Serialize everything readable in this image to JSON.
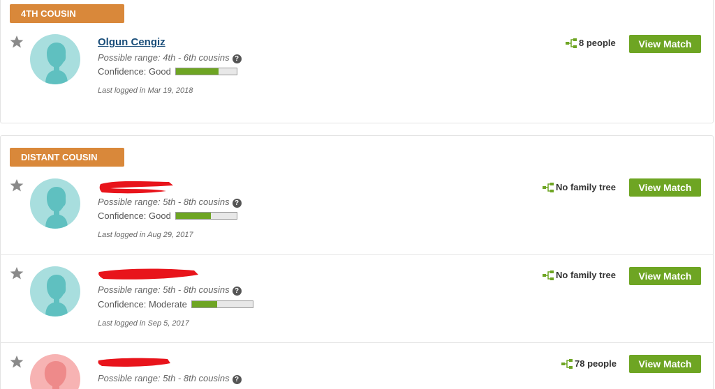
{
  "groups": [
    {
      "label": "4TH COUSIN"
    },
    {
      "label": "DISTANT COUSIN"
    }
  ],
  "matches": [
    {
      "name": "Olgun Cengiz",
      "range": "Possible range: 4th - 6th cousins",
      "confidence_text": "Confidence: Good",
      "confidence_level": 0.7,
      "last_logged": "Last logged in Mar 19, 2018",
      "tree": "8 people",
      "button": "View Match",
      "avatar": "male-silhouette"
    },
    {
      "name_redacted": true,
      "range": "Possible range: 5th - 8th cousins",
      "confidence_text": "Confidence: Good",
      "confidence_level": 0.58,
      "last_logged": "Last logged in Aug 29, 2017",
      "tree": "No family tree",
      "button": "View Match",
      "avatar": "male-silhouette"
    },
    {
      "name_redacted": true,
      "range": "Possible range: 5th - 8th cousins",
      "confidence_text": "Confidence: Moderate",
      "confidence_level": 0.42,
      "last_logged": "Last logged in Sep 5, 2017",
      "tree": "No family tree",
      "button": "View Match",
      "avatar": "male-silhouette"
    },
    {
      "name_redacted": true,
      "range": "Possible range: 5th - 8th cousins",
      "tree": "78 people",
      "button": "View Match",
      "avatar": "female-silhouette"
    }
  ],
  "colors": {
    "group_label": "#d9883a",
    "button": "#6ea523",
    "confidence_fill": "#6ea523",
    "link": "#1a4e7a",
    "avatar_male_bg": "#a8dede",
    "avatar_male_fg": "#5fc0c0",
    "avatar_female_bg": "#f7b3b3",
    "avatar_female_fg": "#ee8a8a",
    "redaction": "#e8141b"
  }
}
